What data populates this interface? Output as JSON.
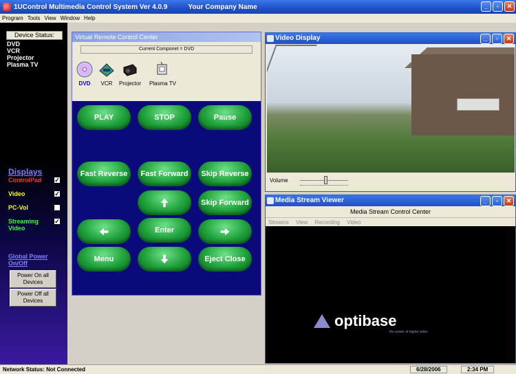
{
  "window": {
    "title": "1UControl Multimedia Control System  Ver 4.0.9",
    "company": "Your Company Name"
  },
  "menu": [
    "Program",
    "Tools",
    "View",
    "Window",
    "Help"
  ],
  "sidebar": {
    "device_status_label": "Device Status:",
    "devices": [
      "DVD",
      "VCR",
      "Projector",
      "Plasma TV"
    ],
    "displays_title": "Displays",
    "displays": [
      {
        "label": "ControlPad",
        "checked": true,
        "color": "#ff3030"
      },
      {
        "label": "Video",
        "checked": true,
        "color": "#ffff00"
      },
      {
        "label": "PC-Vol",
        "checked": false,
        "color": "#ffff00"
      },
      {
        "label": "Streaming Video",
        "checked": true,
        "color": "#30ff30"
      }
    ],
    "global_power_label": "Global Power On/Off",
    "power_on_label": "Power On all Devices",
    "power_off_label": "Power Off all Devices"
  },
  "remote": {
    "title": "Virtual Remote Control Center",
    "current_component": "Current Componet = DVD",
    "devices": [
      "DVD",
      "VCR",
      "Projector",
      "Plasma TV"
    ],
    "buttons": {
      "play": "PLAY",
      "stop": "STOP",
      "pause": "Pause",
      "fast_reverse": "Fast Reverse",
      "fast_forward": "Fast Forward",
      "skip_reverse": "Skip Reverse",
      "skip_forward": "Skip Forward",
      "enter": "Enter",
      "menu": "Menu",
      "eject": "Eject Close"
    }
  },
  "video": {
    "title": "Video Display",
    "volume_label": "Volume",
    "volume_level": 0.55
  },
  "stream": {
    "title": "Media Stream Viewer",
    "control_center": "Media Stream Control Center",
    "menu": [
      "Streams",
      "View",
      "Recording",
      "Video"
    ],
    "logo": "optibase",
    "logo_tagline": "the power of digital video"
  },
  "status": {
    "network": "Network Status: Not Connected",
    "date": "6/28/2006",
    "time": "2:34 PM"
  }
}
